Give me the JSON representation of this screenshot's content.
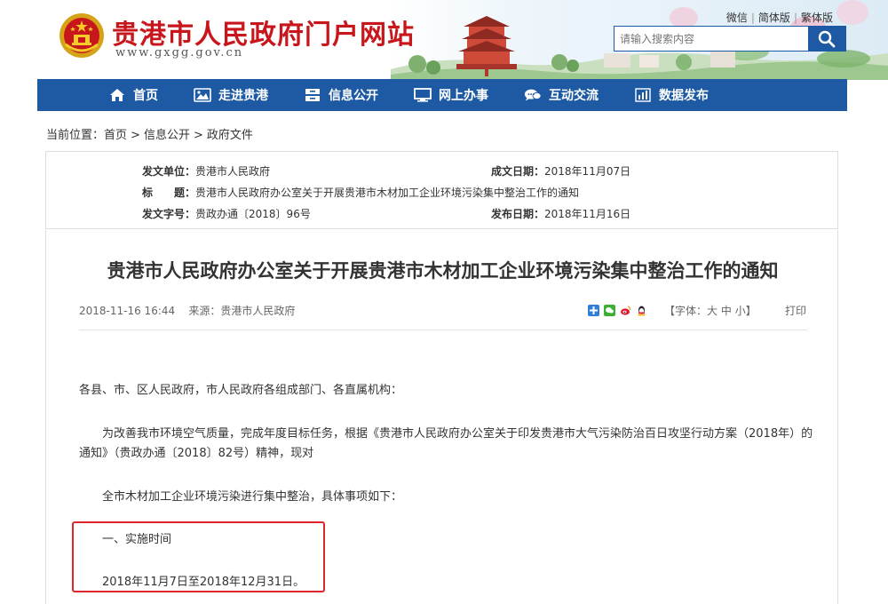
{
  "header": {
    "site_title": "贵港市人民政府门户网站",
    "site_url": "www.gxgg.gov.cn",
    "toplinks": [
      "微信",
      "简体版",
      "繁体版"
    ],
    "search_placeholder": "请输入搜索内容",
    "brand_color": "#c8161d",
    "accent_color": "#1d5aa3"
  },
  "nav": {
    "items": [
      {
        "label": "首页",
        "icon": "home-icon"
      },
      {
        "label": "走进贵港",
        "icon": "picture-icon"
      },
      {
        "label": "信息公开",
        "icon": "cabinet-icon"
      },
      {
        "label": "网上办事",
        "icon": "monitor-icon"
      },
      {
        "label": "互动交流",
        "icon": "chat-icon"
      },
      {
        "label": "数据发布",
        "icon": "bar-chart-icon"
      }
    ]
  },
  "breadcrumb": {
    "prefix": "当前位置：",
    "items": [
      "首页",
      "信息公开",
      "政府文件"
    ],
    "separator": ">"
  },
  "meta": {
    "issuer_label": "发文单位：",
    "issuer": "贵港市人民政府",
    "date_made_label": "成文日期：",
    "date_made": "2018年11月07日",
    "title_label": "标　　题：",
    "title": "贵港市人民政府办公室关于开展贵港市木材加工企业环境污染集中整治工作的通知",
    "doc_no_label": "发文字号：",
    "doc_no": "贵政办通〔2018〕96号",
    "pub_date_label": "发布日期：",
    "pub_date": "2018年11月16日"
  },
  "article": {
    "title": "贵港市人民政府办公室关于开展贵港市木材加工企业环境污染集中整治工作的通知",
    "datetime": "2018-11-16 16:44",
    "source": "来源：贵港市人民政府",
    "font_label_open": "【字体：",
    "font_sizes": [
      "大",
      "中",
      "小"
    ],
    "font_label_close": "】",
    "print": "打印",
    "para1": "各县、市、区人民政府，市人民政府各组成部门、各直属机构：",
    "para2_line1": "为改善我市环境空气质量，完成年度目标任务，根据《贵港市人民政府办公室关于印发贵港市大气污染防治百日攻坚行动方案（2018年）的",
    "para2_line2": "通知》（贵政办通〔2018〕82号）精神，现对",
    "para3": "全市木材加工企业环境污染进行集中整治，具体事项如下：",
    "section1_heading": "一、实施时间",
    "section1_body": "2018年11月7日至2018年12月31日。",
    "highlight_color": "#e0262c"
  }
}
